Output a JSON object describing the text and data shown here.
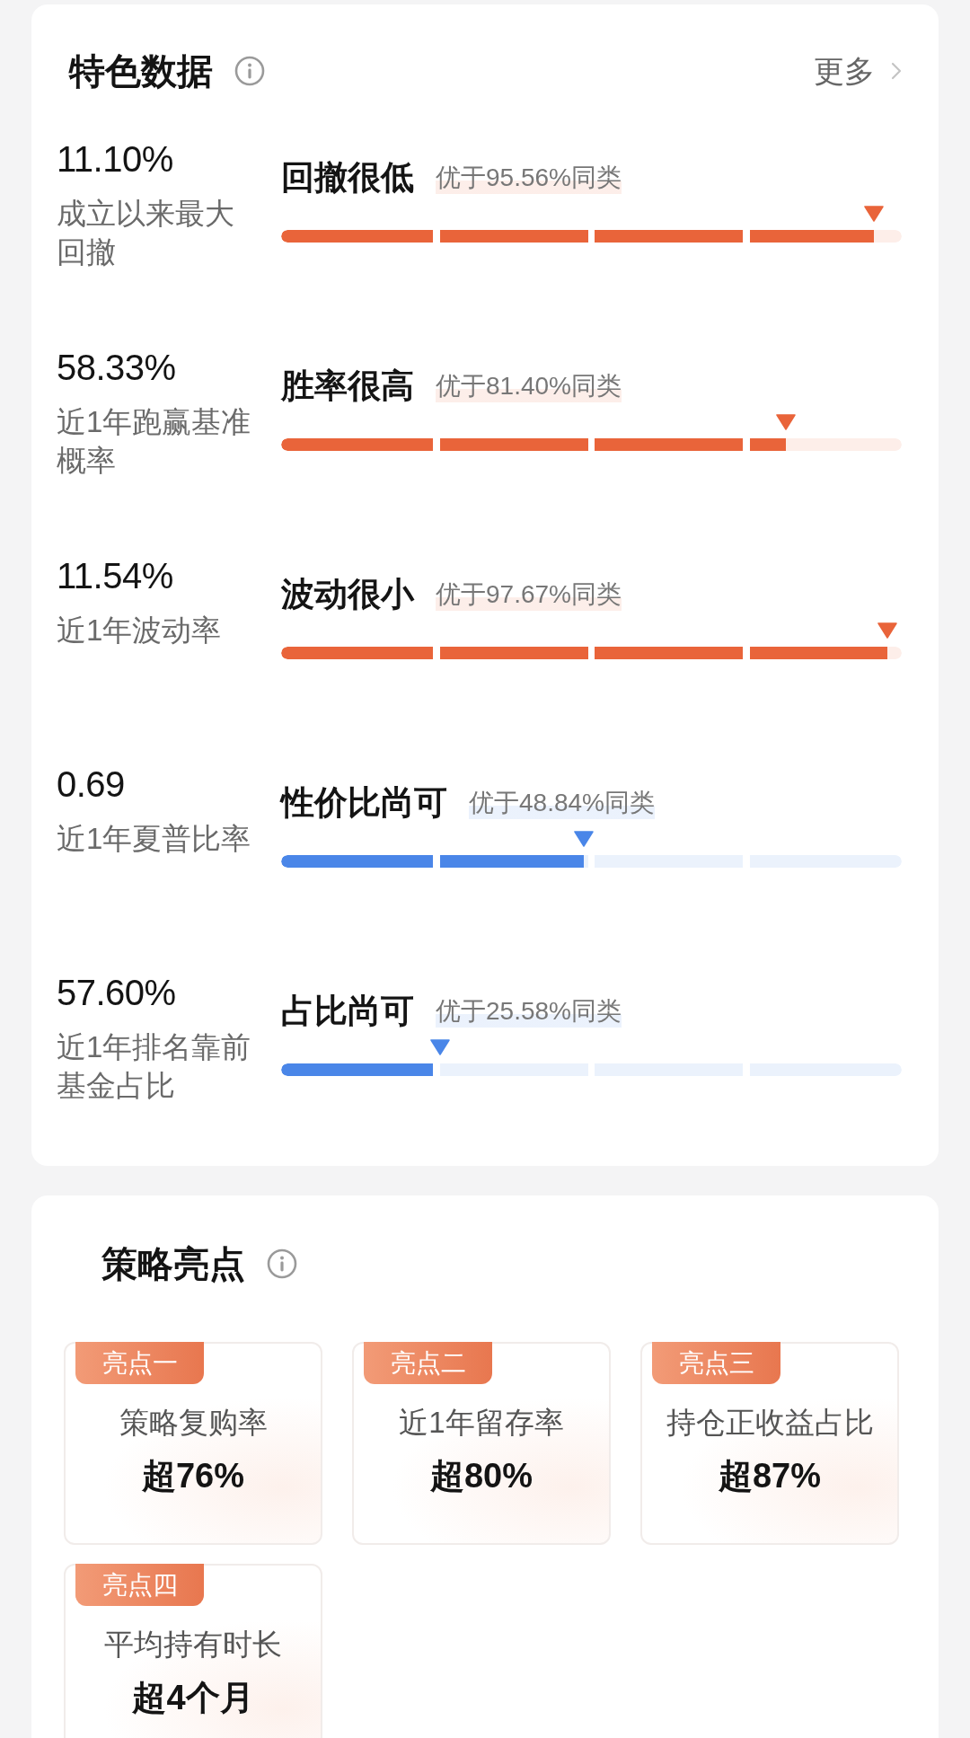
{
  "stats": {
    "title": "特色数据",
    "more": "更多"
  },
  "metrics": [
    {
      "value": "11.10%",
      "label": "成立以来最大回撤",
      "verdict": "回撤很低",
      "rank": "优于95.56%同类",
      "level": 0.9556,
      "color": "#e9643a"
    },
    {
      "value": "58.33%",
      "label": "近1年跑赢基准概率",
      "verdict": "胜率很高",
      "rank": "优于81.40%同类",
      "level": 0.814,
      "color": "#e9643a"
    },
    {
      "value": "11.54%",
      "label": "近1年波动率",
      "verdict": "波动很小",
      "rank": "优于97.67%同类",
      "level": 0.9767,
      "color": "#e9643a"
    },
    {
      "value": "0.69",
      "label": "近1年夏普比率",
      "verdict": "性价比尚可",
      "rank": "优于48.84%同类",
      "level": 0.4884,
      "color": "#4a86e8"
    },
    {
      "value": "57.60%",
      "label": "近1年排名靠前基金占比",
      "verdict": "占比尚可",
      "rank": "优于25.58%同类",
      "level": 0.2558,
      "color": "#4a86e8"
    }
  ],
  "highlights": {
    "title": "策略亮点",
    "items": [
      {
        "tag": "亮点一",
        "label": "策略复购率",
        "value": "超76%"
      },
      {
        "tag": "亮点二",
        "label": "近1年留存率",
        "value": "超80%"
      },
      {
        "tag": "亮点三",
        "label": "持仓正收益占比",
        "value": "超87%"
      },
      {
        "tag": "亮点四",
        "label": "平均持有时长",
        "value": "超4个月"
      }
    ]
  }
}
